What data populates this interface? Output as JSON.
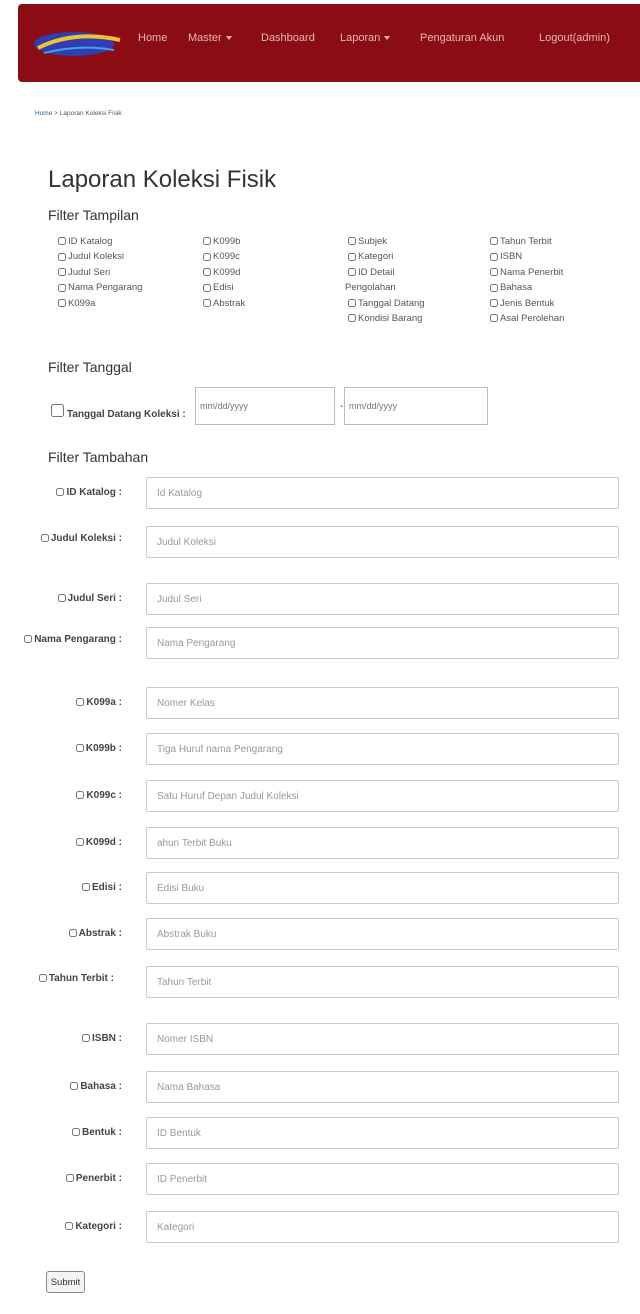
{
  "nav": {
    "items": [
      {
        "label": "Home",
        "dropdown": false
      },
      {
        "label": "Master",
        "dropdown": true
      },
      {
        "label": "Dashboard",
        "dropdown": false
      },
      {
        "label": "Laporan",
        "dropdown": true
      },
      {
        "label": "Pengaturan Akun",
        "dropdown": false
      },
      {
        "label": "Logout(admin)",
        "dropdown": false
      }
    ]
  },
  "breadcrumb": {
    "home": "Home",
    "separator": ">",
    "current": "Laporan Koleksi Fisik"
  },
  "page_title": "Laporan Koleksi Fisik",
  "filter_tampilan": {
    "title": "Filter Tampilan",
    "columns": [
      [
        "ID Katalog",
        "Judul Koleksi",
        "Judul Seri",
        "Nama Pengarang",
        "K099a"
      ],
      [
        "K099b",
        "K099c",
        "K099d",
        "Edisi",
        "Abstrak"
      ],
      [
        "Subjek",
        "Kategori",
        "ID Detail",
        "Pengolahan",
        "Tanggal Datang",
        "Kondisi Barang"
      ],
      [
        "Tahun Terbit",
        "ISBN",
        "Nama Penerbit",
        "Bahasa",
        "Jenis Bentuk",
        "Asal Perolehan"
      ]
    ]
  },
  "filter_tanggal": {
    "title": "Filter Tanggal",
    "label": "Tanggal Datang Koleksi :",
    "from_placeholder": "mm/dd/yyyy",
    "separator": "-",
    "to_placeholder": "mm/dd/yyyy"
  },
  "filter_tambahan": {
    "title": "Filter Tambahan",
    "fields": [
      {
        "label": "ID Katalog :",
        "placeholder": "Id Katalog"
      },
      {
        "label": "Judul Koleksi :",
        "placeholder": "Judul Koleksi"
      },
      {
        "label": "Judul Seri :",
        "placeholder": "Judul Seri"
      },
      {
        "label": "Nama Pengarang :",
        "placeholder": "Nama Pengarang"
      },
      {
        "label": "K099a :",
        "placeholder": "Nomer Kelas"
      },
      {
        "label": "K099b :",
        "placeholder": "Tiga Huruf nama Pengarang"
      },
      {
        "label": "K099c :",
        "placeholder": "Satu Huruf Depan Judul Koleksi"
      },
      {
        "label": "K099d :",
        "placeholder": "ahun Terbit Buku"
      },
      {
        "label": "Edisi :",
        "placeholder": "Edisi Buku"
      },
      {
        "label": "Abstrak :",
        "placeholder": "Abstrak Buku"
      },
      {
        "label": "Tahun Terbit :",
        "placeholder": "Tahun Terbit"
      },
      {
        "label": "ISBN :",
        "placeholder": "Nomer ISBN"
      },
      {
        "label": "Bahasa :",
        "placeholder": "Nama Bahasa"
      },
      {
        "label": "Bentuk :",
        "placeholder": "ID Bentuk"
      },
      {
        "label": "Penerbit :",
        "placeholder": "ID Penerbit"
      },
      {
        "label": "Kategori :",
        "placeholder": "Kategori"
      }
    ]
  },
  "submit_label": "Submit"
}
